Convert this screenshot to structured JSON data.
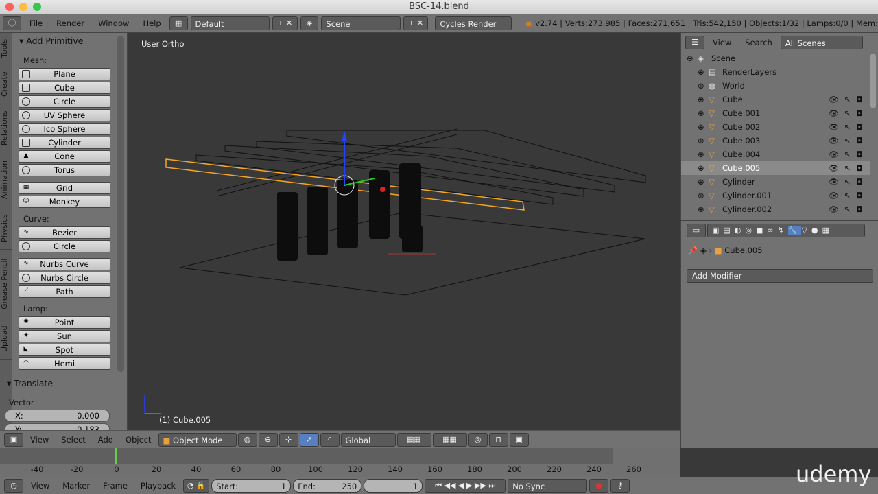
{
  "window": {
    "title": "BSC-14.blend"
  },
  "info": {
    "menus": [
      "File",
      "Render",
      "Window",
      "Help"
    ],
    "layout": "Default",
    "scene": "Scene",
    "engine": "Cycles Render",
    "stats": "v2.74 | Verts:273,985 | Faces:271,651 | Tris:542,150 | Objects:1/32 | Lamps:0/0 | Mem:"
  },
  "tabs": [
    "Tools",
    "Create",
    "Relations",
    "Animation",
    "Physics",
    "Grease Pencil",
    "Upload"
  ],
  "tools": {
    "title": "Add Primitive",
    "mesh_label": "Mesh:",
    "mesh": [
      "Plane",
      "Cube",
      "Circle",
      "UV Sphere",
      "Ico Sphere",
      "Cylinder",
      "Cone",
      "Torus"
    ],
    "extra": [
      "Grid",
      "Monkey"
    ],
    "curve_label": "Curve:",
    "curve": [
      "Bezier",
      "Circle"
    ],
    "nurbs": [
      "Nurbs Curve",
      "Nurbs Circle",
      "Path"
    ],
    "lamp_label": "Lamp:",
    "lamp": [
      "Point",
      "Sun",
      "Spot",
      "Hemi"
    ]
  },
  "operator": {
    "title": "Translate",
    "vector_label": "Vector",
    "x_label": "X:",
    "x": "0.000",
    "y_label": "Y:",
    "y": "0.183"
  },
  "viewport": {
    "view_name": "User Ortho",
    "object_info": "(1) Cube.005"
  },
  "view_header": {
    "menus": [
      "View",
      "Select",
      "Add",
      "Object"
    ],
    "mode": "Object Mode",
    "orientation": "Global"
  },
  "outliner": {
    "menus": [
      "View",
      "Search"
    ],
    "filter": "All Scenes",
    "items": [
      {
        "name": "Scene",
        "level": 0
      },
      {
        "name": "RenderLayers",
        "level": 1
      },
      {
        "name": "World",
        "level": 1
      },
      {
        "name": "Cube",
        "level": 1
      },
      {
        "name": "Cube.001",
        "level": 1
      },
      {
        "name": "Cube.002",
        "level": 1
      },
      {
        "name": "Cube.003",
        "level": 1
      },
      {
        "name": "Cube.004",
        "level": 1
      },
      {
        "name": "Cube.005",
        "level": 1,
        "selected": true
      },
      {
        "name": "Cylinder",
        "level": 1
      },
      {
        "name": "Cylinder.001",
        "level": 1
      },
      {
        "name": "Cylinder.002",
        "level": 1
      }
    ]
  },
  "properties": {
    "object": "Cube.005",
    "add_modifier": "Add Modifier"
  },
  "timeline": {
    "ticks": [
      "-40",
      "-20",
      "0",
      "20",
      "40",
      "60",
      "80",
      "100",
      "120",
      "140",
      "160",
      "180",
      "200",
      "220",
      "240",
      "260"
    ],
    "current_frame": "1",
    "menus": [
      "View",
      "Marker",
      "Frame",
      "Playback"
    ],
    "start_label": "Start:",
    "start": "1",
    "end_label": "End:",
    "end": "250",
    "frame": "1",
    "sync": "No Sync"
  },
  "watermark": "udemy",
  "colors": {
    "selection": "#f5a623",
    "viewport": "#393939",
    "panel": "#727272"
  }
}
